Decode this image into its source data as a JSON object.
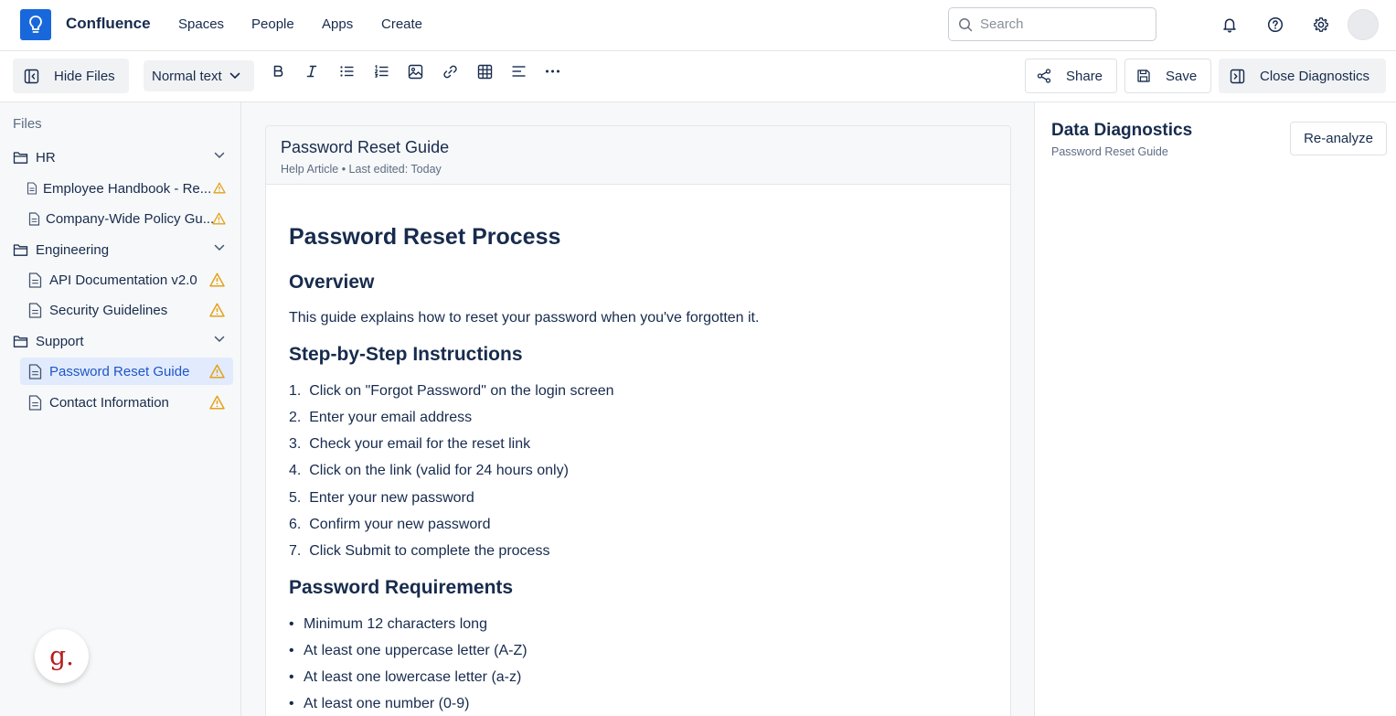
{
  "nav": {
    "brand": "Confluence",
    "links": [
      "Spaces",
      "People",
      "Apps",
      "Create"
    ],
    "search_placeholder": "Search"
  },
  "toolbar": {
    "hide_files": "Hide Files",
    "text_style": "Normal text",
    "share": "Share",
    "save": "Save",
    "close_diagnostics": "Close Diagnostics"
  },
  "sidebar": {
    "title": "Files",
    "folders": [
      {
        "name": "HR",
        "files": [
          "Employee Handbook - Re...",
          "Company-Wide Policy Gu..."
        ]
      },
      {
        "name": "Engineering",
        "files": [
          "API Documentation v2.0",
          "Security Guidelines"
        ]
      },
      {
        "name": "Support",
        "files": [
          "Password Reset Guide",
          "Contact Information"
        ]
      }
    ],
    "active_file": "Password Reset Guide",
    "badge_letter": "g."
  },
  "document": {
    "title": "Password Reset Guide",
    "meta": "Help Article • Last edited: Today",
    "heading": "Password Reset Process",
    "overview_heading": "Overview",
    "overview_text": "This guide explains how to reset your password when you've forgotten it.",
    "steps_heading": "Step-by-Step Instructions",
    "steps": [
      "Click on \"Forgot Password\" on the login screen",
      "Enter your email address",
      "Check your email for the reset link",
      "Click on the link (valid for 24 hours only)",
      "Enter your new password",
      "Confirm your new password",
      "Click Submit to complete the process"
    ],
    "requirements_heading": "Password Requirements",
    "requirements": [
      "Minimum 12 characters long",
      "At least one uppercase letter (A-Z)",
      "At least one lowercase letter (a-z)",
      "At least one number (0-9)"
    ]
  },
  "diagnostics": {
    "title": "Data Diagnostics",
    "subtitle": "Password Reset Guide",
    "reanalyze": "Re-analyze"
  },
  "colors": {
    "brand_blue": "#1868db",
    "active_bg": "#e1ebfd",
    "active_text": "#1f55c6",
    "warning": "#e2a21b"
  }
}
